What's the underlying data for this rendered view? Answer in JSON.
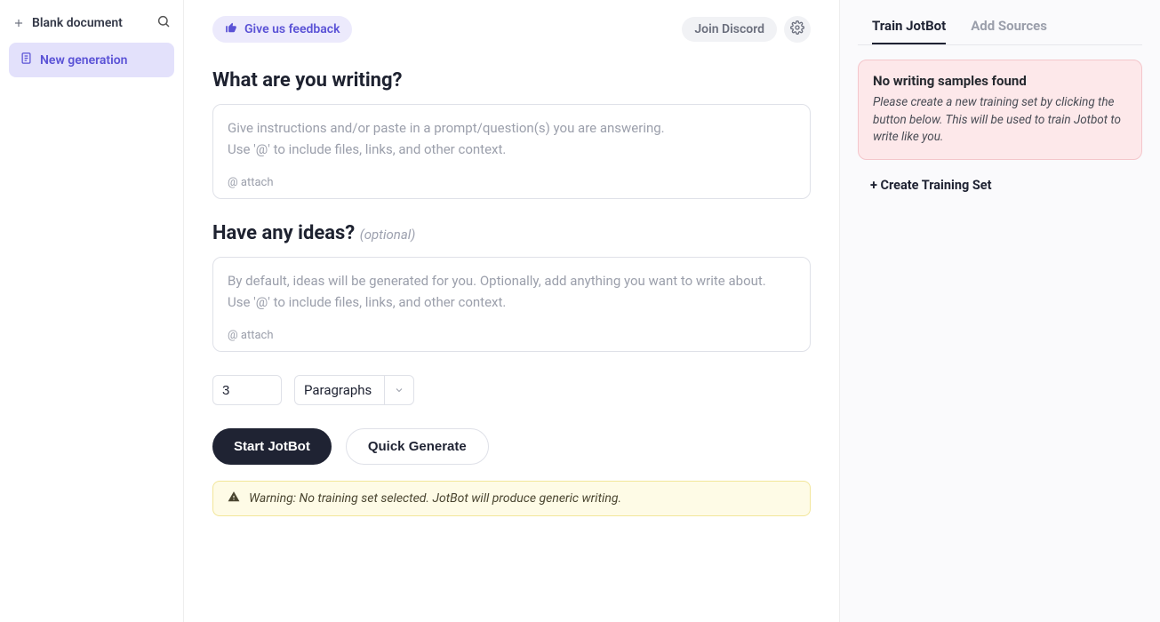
{
  "sidebar": {
    "blank_doc_label": "Blank document",
    "items": [
      {
        "label": "New generation"
      }
    ]
  },
  "header": {
    "feedback_label": "Give us feedback",
    "discord_label": "Join Discord"
  },
  "section_writing": {
    "title": "What are you writing?",
    "placeholder": "Give instructions and/or paste in a prompt/question(s) you are answering.\nUse '@' to include files, links, and other context.",
    "attach_label": "@ attach"
  },
  "section_ideas": {
    "title": "Have any ideas? ",
    "optional_label": "(optional)",
    "placeholder": "By default, ideas will be generated for you. Optionally, add anything you want to write about.\nUse '@' to include files, links, and other context.",
    "attach_label": "@ attach"
  },
  "controls": {
    "count_value": "3",
    "unit_label": "Paragraphs"
  },
  "actions": {
    "primary_label": "Start JotBot",
    "secondary_label": "Quick Generate"
  },
  "warning": {
    "text": "Warning: No training set selected. JotBot will produce generic writing."
  },
  "right": {
    "tabs": [
      {
        "label": "Train JotBot"
      },
      {
        "label": "Add Sources"
      }
    ],
    "alert": {
      "title": "No writing samples found",
      "text": "Please create a new training set by clicking the button below. This will be used to train Jotbot to write like you."
    },
    "create_label": "+ Create Training Set"
  }
}
